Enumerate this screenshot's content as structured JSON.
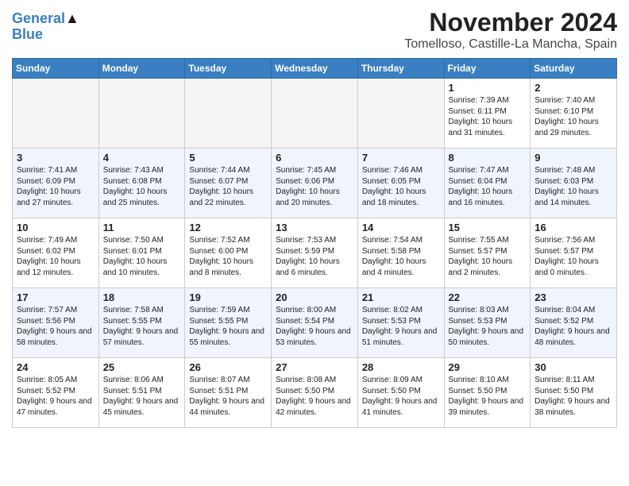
{
  "header": {
    "logo_line1": "General",
    "logo_line2": "Blue",
    "month": "November 2024",
    "location": "Tomelloso, Castille-La Mancha, Spain"
  },
  "days_of_week": [
    "Sunday",
    "Monday",
    "Tuesday",
    "Wednesday",
    "Thursday",
    "Friday",
    "Saturday"
  ],
  "weeks": [
    [
      {
        "day": "",
        "info": "",
        "empty": true
      },
      {
        "day": "",
        "info": "",
        "empty": true
      },
      {
        "day": "",
        "info": "",
        "empty": true
      },
      {
        "day": "",
        "info": "",
        "empty": true
      },
      {
        "day": "",
        "info": "",
        "empty": true
      },
      {
        "day": "1",
        "info": "Sunrise: 7:39 AM\nSunset: 6:11 PM\nDaylight: 10 hours and 31 minutes.",
        "empty": false
      },
      {
        "day": "2",
        "info": "Sunrise: 7:40 AM\nSunset: 6:10 PM\nDaylight: 10 hours and 29 minutes.",
        "empty": false
      }
    ],
    [
      {
        "day": "3",
        "info": "Sunrise: 7:41 AM\nSunset: 6:09 PM\nDaylight: 10 hours and 27 minutes.",
        "empty": false
      },
      {
        "day": "4",
        "info": "Sunrise: 7:43 AM\nSunset: 6:08 PM\nDaylight: 10 hours and 25 minutes.",
        "empty": false
      },
      {
        "day": "5",
        "info": "Sunrise: 7:44 AM\nSunset: 6:07 PM\nDaylight: 10 hours and 22 minutes.",
        "empty": false
      },
      {
        "day": "6",
        "info": "Sunrise: 7:45 AM\nSunset: 6:06 PM\nDaylight: 10 hours and 20 minutes.",
        "empty": false
      },
      {
        "day": "7",
        "info": "Sunrise: 7:46 AM\nSunset: 6:05 PM\nDaylight: 10 hours and 18 minutes.",
        "empty": false
      },
      {
        "day": "8",
        "info": "Sunrise: 7:47 AM\nSunset: 6:04 PM\nDaylight: 10 hours and 16 minutes.",
        "empty": false
      },
      {
        "day": "9",
        "info": "Sunrise: 7:48 AM\nSunset: 6:03 PM\nDaylight: 10 hours and 14 minutes.",
        "empty": false
      }
    ],
    [
      {
        "day": "10",
        "info": "Sunrise: 7:49 AM\nSunset: 6:02 PM\nDaylight: 10 hours and 12 minutes.",
        "empty": false
      },
      {
        "day": "11",
        "info": "Sunrise: 7:50 AM\nSunset: 6:01 PM\nDaylight: 10 hours and 10 minutes.",
        "empty": false
      },
      {
        "day": "12",
        "info": "Sunrise: 7:52 AM\nSunset: 6:00 PM\nDaylight: 10 hours and 8 minutes.",
        "empty": false
      },
      {
        "day": "13",
        "info": "Sunrise: 7:53 AM\nSunset: 5:59 PM\nDaylight: 10 hours and 6 minutes.",
        "empty": false
      },
      {
        "day": "14",
        "info": "Sunrise: 7:54 AM\nSunset: 5:58 PM\nDaylight: 10 hours and 4 minutes.",
        "empty": false
      },
      {
        "day": "15",
        "info": "Sunrise: 7:55 AM\nSunset: 5:57 PM\nDaylight: 10 hours and 2 minutes.",
        "empty": false
      },
      {
        "day": "16",
        "info": "Sunrise: 7:56 AM\nSunset: 5:57 PM\nDaylight: 10 hours and 0 minutes.",
        "empty": false
      }
    ],
    [
      {
        "day": "17",
        "info": "Sunrise: 7:57 AM\nSunset: 5:56 PM\nDaylight: 9 hours and 58 minutes.",
        "empty": false
      },
      {
        "day": "18",
        "info": "Sunrise: 7:58 AM\nSunset: 5:55 PM\nDaylight: 9 hours and 57 minutes.",
        "empty": false
      },
      {
        "day": "19",
        "info": "Sunrise: 7:59 AM\nSunset: 5:55 PM\nDaylight: 9 hours and 55 minutes.",
        "empty": false
      },
      {
        "day": "20",
        "info": "Sunrise: 8:00 AM\nSunset: 5:54 PM\nDaylight: 9 hours and 53 minutes.",
        "empty": false
      },
      {
        "day": "21",
        "info": "Sunrise: 8:02 AM\nSunset: 5:53 PM\nDaylight: 9 hours and 51 minutes.",
        "empty": false
      },
      {
        "day": "22",
        "info": "Sunrise: 8:03 AM\nSunset: 5:53 PM\nDaylight: 9 hours and 50 minutes.",
        "empty": false
      },
      {
        "day": "23",
        "info": "Sunrise: 8:04 AM\nSunset: 5:52 PM\nDaylight: 9 hours and 48 minutes.",
        "empty": false
      }
    ],
    [
      {
        "day": "24",
        "info": "Sunrise: 8:05 AM\nSunset: 5:52 PM\nDaylight: 9 hours and 47 minutes.",
        "empty": false
      },
      {
        "day": "25",
        "info": "Sunrise: 8:06 AM\nSunset: 5:51 PM\nDaylight: 9 hours and 45 minutes.",
        "empty": false
      },
      {
        "day": "26",
        "info": "Sunrise: 8:07 AM\nSunset: 5:51 PM\nDaylight: 9 hours and 44 minutes.",
        "empty": false
      },
      {
        "day": "27",
        "info": "Sunrise: 8:08 AM\nSunset: 5:50 PM\nDaylight: 9 hours and 42 minutes.",
        "empty": false
      },
      {
        "day": "28",
        "info": "Sunrise: 8:09 AM\nSunset: 5:50 PM\nDaylight: 9 hours and 41 minutes.",
        "empty": false
      },
      {
        "day": "29",
        "info": "Sunrise: 8:10 AM\nSunset: 5:50 PM\nDaylight: 9 hours and 39 minutes.",
        "empty": false
      },
      {
        "day": "30",
        "info": "Sunrise: 8:11 AM\nSunset: 5:50 PM\nDaylight: 9 hours and 38 minutes.",
        "empty": false
      }
    ]
  ]
}
